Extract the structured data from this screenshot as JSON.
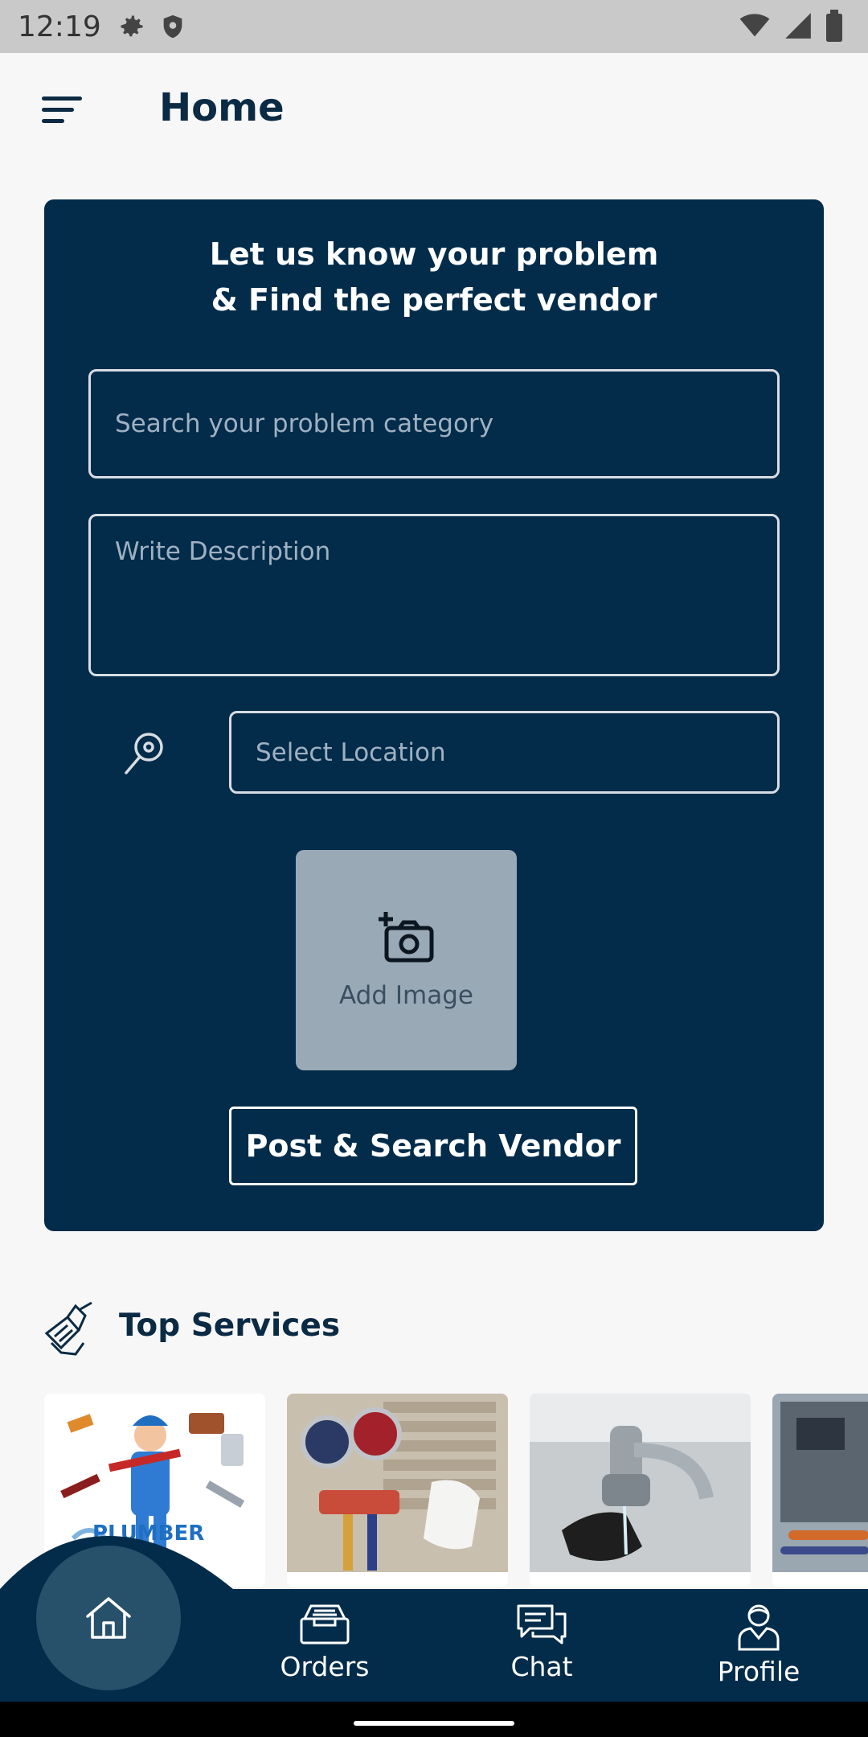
{
  "status_bar": {
    "time": "12:19",
    "icons": [
      "settings-icon",
      "shield-icon",
      "wifi-icon",
      "signal-icon",
      "battery-icon"
    ]
  },
  "app_bar": {
    "title": "Home",
    "menu_icon": "menu-icon"
  },
  "problem_card": {
    "heading_line1": "Let us know your problem",
    "heading_line2": "& Find the perfect vendor",
    "search_placeholder": "Search your problem category",
    "description_placeholder": "Write Description",
    "location_placeholder": "Select Location",
    "add_image_label": "Add Image",
    "submit_label": "Post & Search Vendor",
    "background_color": "#022c4a"
  },
  "top_services": {
    "title": "Top Services",
    "items": [
      {
        "name": "plumber",
        "label": "PLUMBER"
      },
      {
        "name": "ac-repair"
      },
      {
        "name": "tap-repair"
      },
      {
        "name": "appliance-repair"
      }
    ]
  },
  "bottom_nav": {
    "items": [
      {
        "icon": "home-icon",
        "label": "",
        "active": true
      },
      {
        "icon": "orders-icon",
        "label": "Orders"
      },
      {
        "icon": "chat-icon",
        "label": "Chat"
      },
      {
        "icon": "profile-icon",
        "label": "Profile"
      }
    ]
  }
}
